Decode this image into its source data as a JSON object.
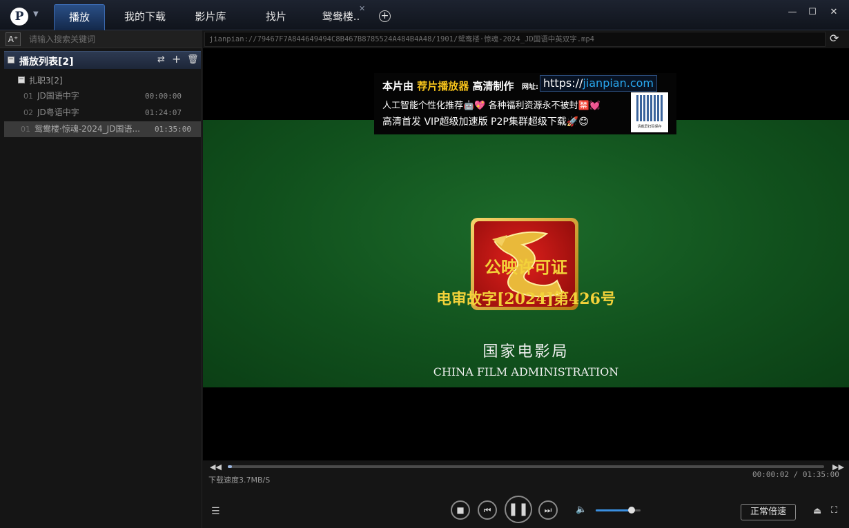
{
  "app": {
    "logo_letter": "P"
  },
  "tabs": [
    {
      "label": "播放"
    },
    {
      "label": "我的下载"
    },
    {
      "label": "影片库"
    },
    {
      "label": "找片"
    },
    {
      "label": "鸳鸯楼.."
    }
  ],
  "sidebar": {
    "font_button": "A⁺",
    "search_placeholder": "请输入搜索关键词",
    "playlist_title": "播放列表[2]",
    "group_label": "扎职3[2]",
    "items": [
      {
        "index": "01",
        "name": "JD国语中字",
        "duration": "00:00:00"
      },
      {
        "index": "02",
        "name": "JD粤语中字",
        "duration": "01:24:07"
      },
      {
        "index": "01",
        "name": "鸳鸯楼·惊魂-2024_JD国语...",
        "duration": "01:35:00"
      }
    ]
  },
  "player": {
    "url": "jianpian://79467F7A844649494C8B467B8785524A484B4A48/1901/鸳鸯楼·惊魂-2024_JD国语中英双字.mp4",
    "banner": {
      "line1_prefix": "本片由",
      "line1_highlight": "荐片播放器",
      "line1_suffix": "高清制作",
      "site_label": "网址:",
      "url_prefix": "https://",
      "url_domain": "jianpian.com",
      "line2": "人工智能个性化推荐🤖💖  各种福利资源永不被封🈲💓",
      "line3": "高清首发  VIP超级加速版  P2P集群超级下载🚀😊",
      "qr_caption": "请截屏扫码保存"
    },
    "license_title": "公映许可证",
    "license_number": "电审故字[2024]第426号",
    "authority_cn": "国家电影局",
    "authority_en": "CHINA FILM ADMINISTRATION"
  },
  "controls": {
    "download_speed": "下载速度3.7MB/S",
    "time": "00:00:02 / 01:35:00",
    "progress": 0.0004,
    "volume": 0.8,
    "rate_label": "正常倍速"
  }
}
